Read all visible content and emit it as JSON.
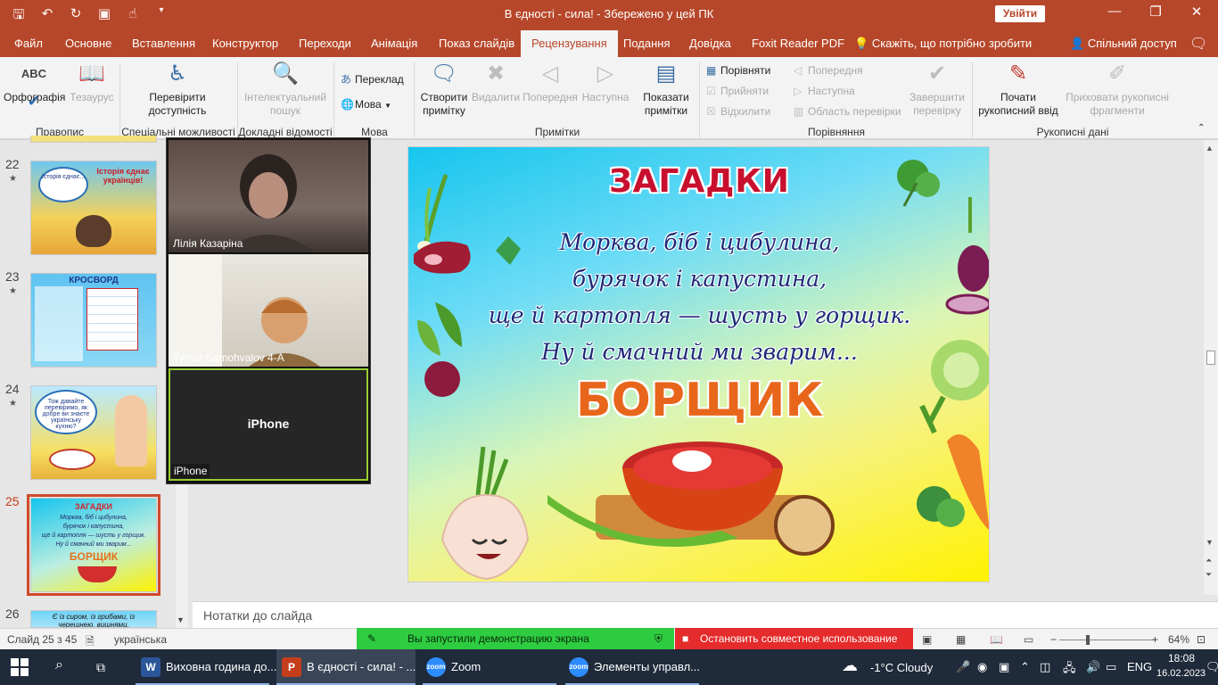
{
  "window": {
    "title": "В єдності - сила! -  Збережено у цей ПК",
    "signin": "Увійти",
    "minimize": "—",
    "restore": "❐",
    "close": "✕"
  },
  "tabs": [
    "Файл",
    "Основне",
    "Вставлення",
    "Конструктор",
    "Переходи",
    "Анімація",
    "Показ слайдів",
    "Рецензування",
    "Подання",
    "Довідка",
    "Foxit Reader PDF"
  ],
  "active_tab": "Рецензування",
  "tellme": "Скажіть, що потрібно зробити",
  "share": "Спільний доступ",
  "ribbon": {
    "spelling": "Орфографія",
    "thesaurus": "Тезаурус",
    "check_access_1": "Перевірити",
    "check_access_2": "доступність",
    "smart_lookup_1": "Інтелектуальний",
    "smart_lookup_2": "пошук",
    "translate": "Переклад",
    "language": "Мова",
    "new_comment_1": "Створити",
    "new_comment_2": "примітку",
    "delete": "Видалити",
    "previous": "Попередня",
    "next": "Наступна",
    "show_comments_1": "Показати",
    "show_comments_2": "примітки",
    "compare": "Порівняти",
    "accept": "Прийняти",
    "reject": "Відхилити",
    "cmp_previous": "Попередня",
    "cmp_next": "Наступна",
    "review_pane": "Область перевірки",
    "end_review_1": "Завершити",
    "end_review_2": "перевірку",
    "start_ink_1": "Почати",
    "start_ink_2": "рукописний ввід",
    "hide_ink_1": "Приховати рукописні",
    "hide_ink_2": "фрагменти",
    "groups": {
      "proofing": "Правопис",
      "accessibility": "Спеціальні можливості",
      "insights": "Докладні відомості",
      "language": "Мова",
      "comments": "Примітки",
      "compare": "Порівняння",
      "ink": "Рукописні дані"
    }
  },
  "thumbnails": [
    {
      "num": "22",
      "title": "Історія єднає українців!"
    },
    {
      "num": "23",
      "title": "КРОСВОРД"
    },
    {
      "num": "24",
      "title": "Тож давайте перевіримо, як добре ви знаєте українську кухню?"
    },
    {
      "num": "25",
      "title": "ЗАГАДКИ",
      "l1": "Морква, біб і цибулина,",
      "l2": "бурячок і капустина,",
      "l3": "ще й картопля — шусть у горщик.",
      "l4": "Ну й смачний ми зварим...",
      "big": "БОРЩИК"
    },
    {
      "num": "26",
      "title": "Є із сиром, із грибами, із черешнею, вишнями."
    }
  ],
  "video": {
    "p1": "Лілія Казаріна",
    "p2": "Tymur Samohvalov 4-А",
    "p3_center": "iPhone",
    "p3": "iPhone"
  },
  "slide": {
    "title": "ЗАГАДКИ",
    "line1": "Морква, біб і цибулина,",
    "line2": "бурячок і капустина,",
    "line3": "ще й картопля — шусть у горщик.",
    "line4": "Ну й смачний ми зварим...",
    "answer": "БОРЩИК"
  },
  "notes_placeholder": "Нотатки до слайда",
  "status": {
    "slide": "Слайд 25 з 45",
    "language": "українська",
    "zoom_share": "Вы запустили демонстрацию экрана",
    "zoom_stop": "Остановить совместное использование",
    "zoom_level": "64%",
    "zoom_minus": "−",
    "zoom_plus": "+"
  },
  "taskbar": {
    "word": "Виховна година до...",
    "ppt": "В єдності - сила! - ...",
    "zoom": "Zoom",
    "zoom_controls": "Элементы управл...",
    "weather": "-1°C  Cloudy",
    "lang": "ENG",
    "time": "18:08",
    "date": "16.02.2023"
  },
  "colors": {
    "accent": "#b7472a",
    "zoom_green": "#2ecc40",
    "zoom_red": "#e52b2b",
    "slide_title": "#c8102e",
    "slide_answer": "#e8661b"
  }
}
